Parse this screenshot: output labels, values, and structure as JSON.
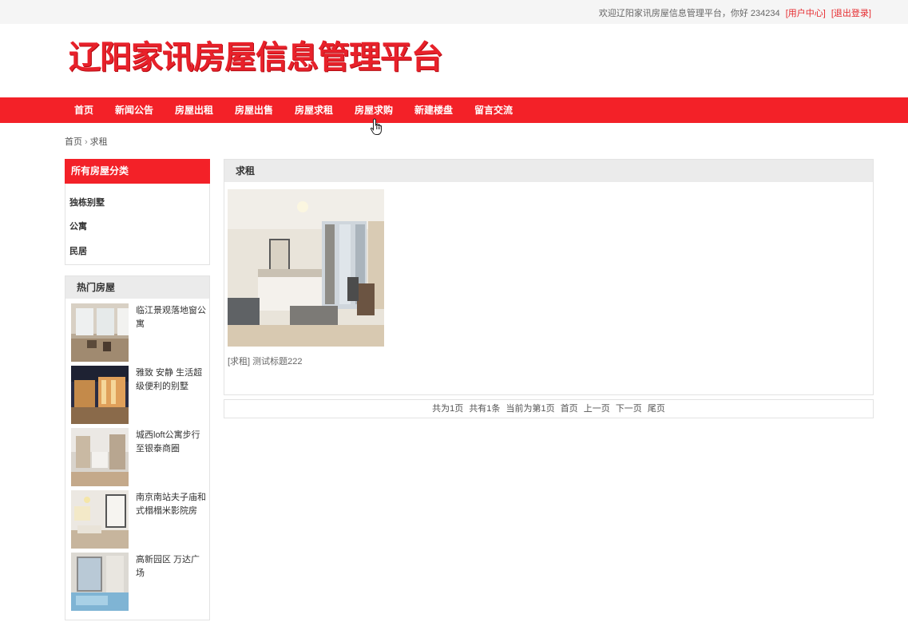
{
  "topbar": {
    "welcome": "欢迎辽阳家讯房屋信息管理平台，你好 234234",
    "user_center": "[用户中心]",
    "logout": "[退出登录]"
  },
  "logo": {
    "text": "辽阳家讯房屋信息管理平台"
  },
  "nav": {
    "items": [
      {
        "label": "首页"
      },
      {
        "label": "新闻公告"
      },
      {
        "label": "房屋出租"
      },
      {
        "label": "房屋出售"
      },
      {
        "label": "房屋求租"
      },
      {
        "label": "房屋求购"
      },
      {
        "label": "新建楼盘"
      },
      {
        "label": "留言交流"
      }
    ]
  },
  "breadcrumb": {
    "home": "首页",
    "separator": "›",
    "current": "求租"
  },
  "categories": {
    "title": "所有房屋分类",
    "items": [
      {
        "label": "独栋别墅"
      },
      {
        "label": "公寓"
      },
      {
        "label": "民居"
      }
    ]
  },
  "hot": {
    "title": "热门房屋",
    "items": [
      {
        "title": "临江景观落地窗公寓"
      },
      {
        "title": "雅致 安静 生活超级便利的别墅"
      },
      {
        "title": "城西loft公寓步行至银泰商圈"
      },
      {
        "title": "南京南站夫子庙和式榻榻米影院房"
      },
      {
        "title": "高新园区 万达广场"
      }
    ]
  },
  "main": {
    "title": "求租",
    "listing": {
      "title": "[求租] 测试标题222"
    }
  },
  "pagination": {
    "total_pages": "共为1页",
    "total_items": "共有1条",
    "current_page": "当前为第1页",
    "first": "首页",
    "prev": "上一页",
    "next": "下一页",
    "last": "尾页"
  },
  "colors": {
    "brand_red": "#f32128",
    "link_red": "#e62a2e",
    "panel_gray": "#ebebeb"
  }
}
